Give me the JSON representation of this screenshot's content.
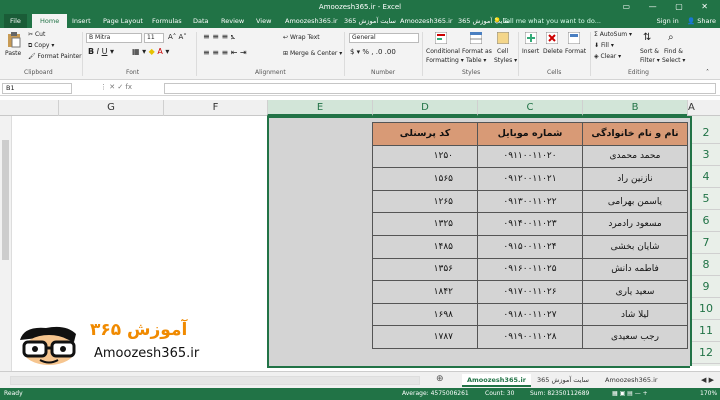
{
  "window": {
    "title": "Amoozesh365.ir - Excel",
    "controls": "▭ — ▢ ✕"
  },
  "tabs": [
    "File",
    "Home",
    "Insert",
    "Page Layout",
    "Formulas",
    "Data",
    "Review",
    "View",
    "Amoozesh365.ir",
    "سایت آموزش 365",
    "Amoozesh365.ir",
    "سایت آموزش 365"
  ],
  "tellme": "Tell me what you want to do...",
  "signin": "Sign in",
  "share": "Share",
  "ribbon": {
    "paste": "Paste",
    "cut": "Cut",
    "copy": "Copy",
    "format_painter": "Format Painter",
    "clipboard": "Clipboard",
    "font_name": "B Mitra",
    "font_size": "11",
    "font": "Font",
    "wrap_text": "Wrap Text",
    "merge_center": "Merge & Center",
    "alignment": "Alignment",
    "number_format": "General",
    "number": "Number",
    "conditional": "Conditional",
    "formatting": "Formatting",
    "format_as": "Format as",
    "table": "Table",
    "cell": "Cell",
    "styles_btn": "Styles",
    "styles": "Styles",
    "insert": "Insert",
    "delete": "Delete",
    "format": "Format",
    "cells": "Cells",
    "autosum": "AutoSum",
    "fill": "Fill",
    "clear": "Clear",
    "sort_filter": "Sort &",
    "filter": "Filter",
    "find": "Find &",
    "select": "Select",
    "editing": "Editing"
  },
  "formula": {
    "namebox": "B1",
    "icons": "⋮  ✕  ✓  fx"
  },
  "columns": [
    "G",
    "F",
    "E",
    "D",
    "C",
    "B",
    "A"
  ],
  "rows": [
    "2",
    "3",
    "4",
    "5",
    "6",
    "7",
    "8",
    "9",
    "10",
    "11",
    "12"
  ],
  "table": {
    "headers": [
      "نام و نام خانوادگی",
      "شماره موبایل",
      "کد پرسنلی"
    ],
    "rows": [
      [
        "محمد محمدی",
        "۰۹۱۱۰۰۱۱۰۲۰",
        "۱۲۵۰"
      ],
      [
        "نازنین راد",
        "۰۹۱۲۰۰۱۱۰۲۱",
        "۱۵۶۵"
      ],
      [
        "یاسمن بهرامی",
        "۰۹۱۳۰۰۱۱۰۲۲",
        "۱۲۶۵"
      ],
      [
        "مسعود رادمرد",
        "۰۹۱۴۰۰۱۱۰۲۳",
        "۱۳۲۵"
      ],
      [
        "شایان بخشی",
        "۰۹۱۵۰۰۱۱۰۲۴",
        "۱۴۸۵"
      ],
      [
        "فاطمه دانش",
        "۰۹۱۶۰۰۱۱۰۲۵",
        "۱۳۵۶"
      ],
      [
        "سعید یاری",
        "۰۹۱۷۰۰۱۱۰۲۶",
        "۱۸۴۲"
      ],
      [
        "لیلا شاد",
        "۰۹۱۸۰۰۱۱۰۲۷",
        "۱۶۹۸"
      ],
      [
        "رجب سعیدی",
        "۰۹۱۹۰۰۱۱۰۲۸",
        "۱۷۸۷"
      ]
    ]
  },
  "logo": {
    "persian": "آموزش ۳۶۵",
    "latin": "Amoozesh365.ir"
  },
  "sheets": [
    "Amoozesh365.ir",
    "سایت آموزش 365",
    "Amoozesh365.ir"
  ],
  "status": {
    "ready": "Ready",
    "average": "Average: 4575006261",
    "count": "Count: 30",
    "sum": "Sum: 82350112689",
    "zoom": "170%"
  },
  "colors": {
    "excel_green": "#217346",
    "header_fill": "#d89a76",
    "selection_gray": "#d4d4d4"
  }
}
